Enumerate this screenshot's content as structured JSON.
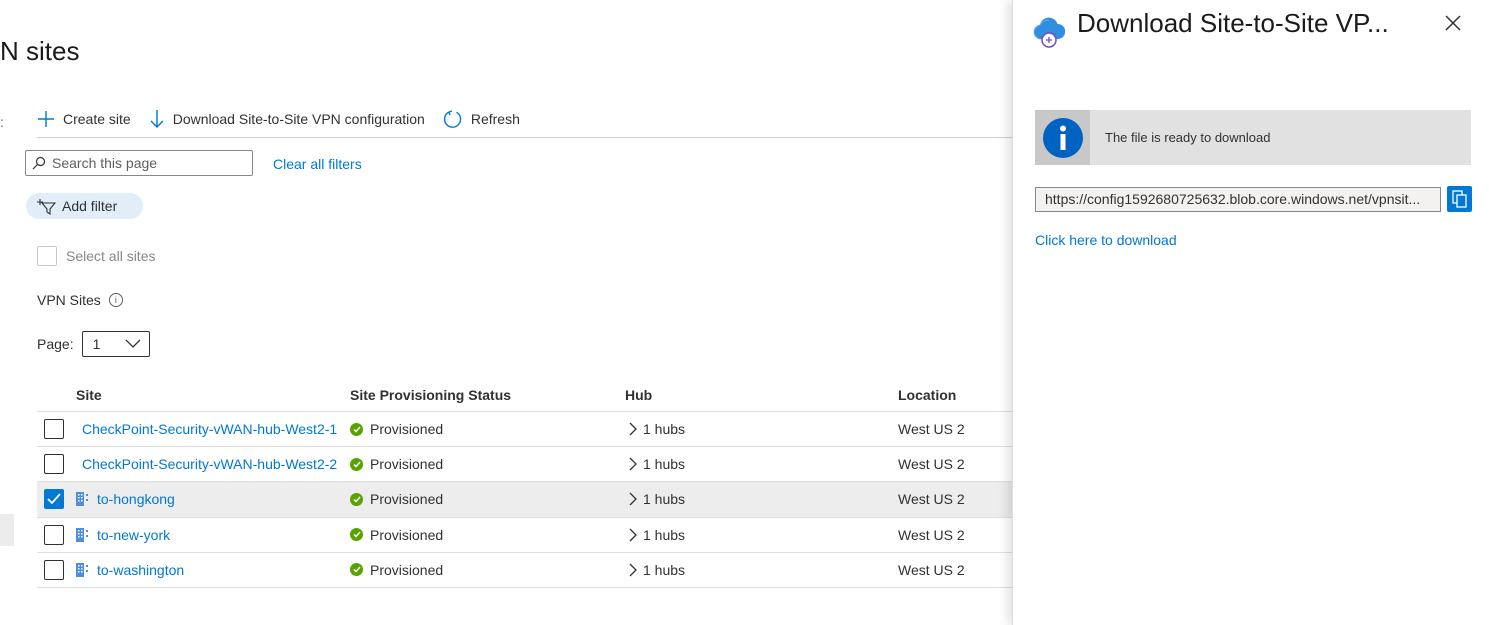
{
  "page": {
    "title": "N sites",
    "left_edge_char": ":"
  },
  "toolbar": {
    "create_label": "Create site",
    "download_label": "Download Site-to-Site VPN configuration",
    "refresh_label": "Refresh"
  },
  "filters": {
    "search_placeholder": "Search this page",
    "clear_label": "Clear all filters",
    "add_filter_label": "Add filter"
  },
  "select_all_label": "Select all sites",
  "section_label": "VPN Sites",
  "pagination": {
    "label": "Page:",
    "value": "1"
  },
  "grid": {
    "columns": {
      "site": "Site",
      "status": "Site Provisioning Status",
      "hub": "Hub",
      "location": "Location"
    },
    "rows": [
      {
        "site": "CheckPoint-Security-vWAN-hub-West2-1",
        "status": "Provisioned",
        "hub": "1 hubs",
        "location": "West US 2",
        "checked": false,
        "has_icon": false
      },
      {
        "site": "CheckPoint-Security-vWAN-hub-West2-2",
        "status": "Provisioned",
        "hub": "1 hubs",
        "location": "West US 2",
        "checked": false,
        "has_icon": false
      },
      {
        "site": "to-hongkong",
        "status": "Provisioned",
        "hub": "1 hubs",
        "location": "West US 2",
        "checked": true,
        "has_icon": true
      },
      {
        "site": "to-new-york",
        "status": "Provisioned",
        "hub": "1 hubs",
        "location": "West US 2",
        "checked": false,
        "has_icon": true
      },
      {
        "site": "to-washington",
        "status": "Provisioned",
        "hub": "1 hubs",
        "location": "West US 2",
        "checked": false,
        "has_icon": true
      }
    ]
  },
  "blade": {
    "title": "Download Site-to-Site VP...",
    "info_message": "The file is ready to download",
    "url": "https://config1592680725632.blob.core.windows.net/vpnsit...",
    "download_link": "Click here to download"
  },
  "colors": {
    "accent": "#0078d4",
    "success": "#57a300",
    "info": "#0063c1"
  }
}
